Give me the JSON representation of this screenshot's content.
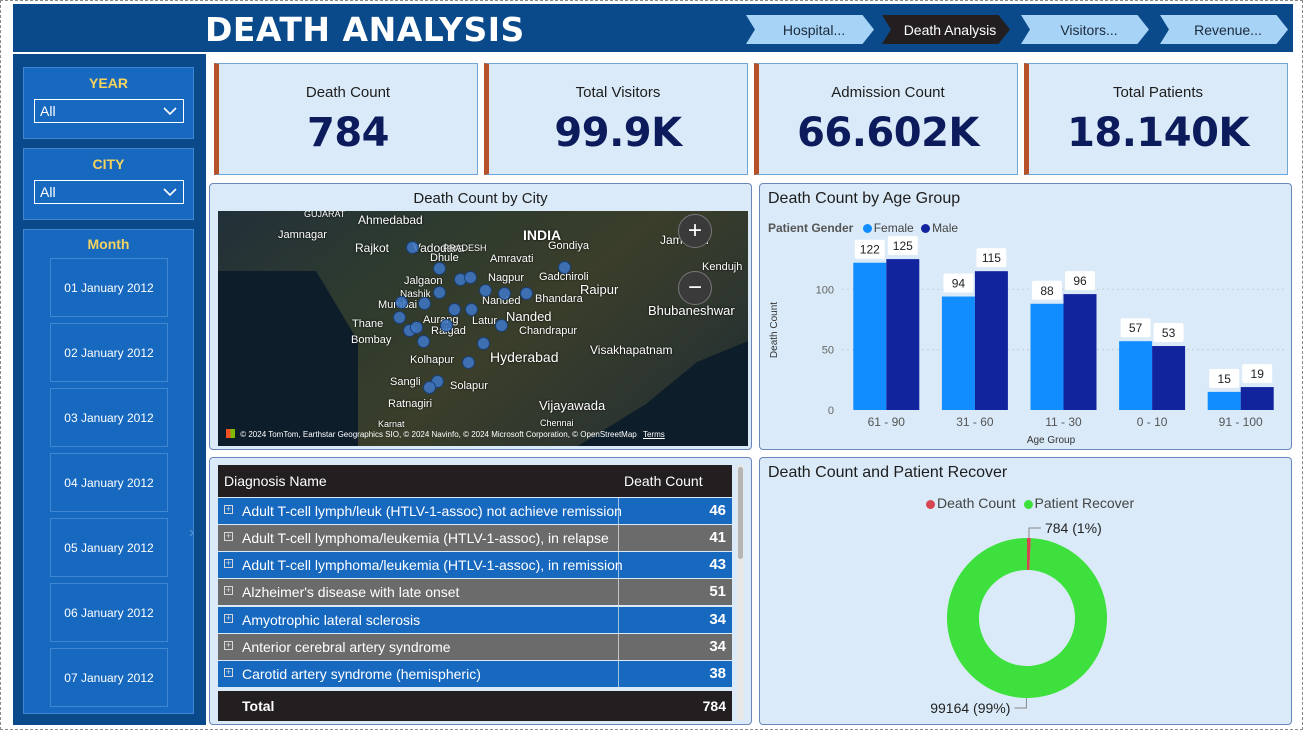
{
  "header": {
    "title": "DEATH ANALYSIS",
    "tabs": [
      {
        "label": "Hospital..."
      },
      {
        "label": "Death Analysis"
      },
      {
        "label": "Visitors..."
      },
      {
        "label": "Revenue..."
      }
    ],
    "active_tab": "Death Analysis"
  },
  "filters": {
    "year": {
      "title": "YEAR",
      "value": "All"
    },
    "city": {
      "title": "CITY",
      "value": "All"
    },
    "month": {
      "title": "Month",
      "items": [
        "01 January 2012",
        "02 January 2012",
        "03 January 2012",
        "04 January 2012",
        "05 January 2012",
        "06 January 2012",
        "07 January 2012"
      ]
    }
  },
  "kpis": [
    {
      "label": "Death Count",
      "value": "784"
    },
    {
      "label": "Total Visitors",
      "value": "99.9K"
    },
    {
      "label": "Admission Count",
      "value": "66.602K"
    },
    {
      "label": "Total Patients",
      "value": "18.140K"
    }
  ],
  "map": {
    "title": "Death Count by City",
    "labels": [
      "GUJARAT",
      "Ahmedabad",
      "Jamnagar",
      "Rajkot",
      "Vadodara",
      "PRADESH",
      "INDIA",
      "Gondiya",
      "Jamshed",
      "Dhule",
      "Amravati",
      "Nagpur",
      "Gadchiroli",
      "Kendujh",
      "Jalgaon",
      "Nashik",
      "Raipur",
      "Mumbai",
      "Nanded",
      "Bhandara",
      "Bhubaneshwar",
      "Thane",
      "Aurang",
      "Raigad",
      "Latur",
      "Nanded",
      "Chandrapur",
      "Bombay",
      "Hyderabad",
      "Visakhapatnam",
      "Kolhapur",
      "Sangli",
      "Solapur",
      "Ratnagiri",
      "Vijayawada",
      "Karnat",
      "Chennai"
    ],
    "attribution": "© 2024 TomTom, Earthstar Geographics SIO, © 2024 Navinfo, © 2024 Microsoft Corporation, © OpenStreetMap",
    "terms": "Terms",
    "zoom_in": "+",
    "zoom_out": "−"
  },
  "table": {
    "columns": [
      "Diagnosis Name",
      "Death Count"
    ],
    "rows": [
      {
        "name": "Adult T-cell lymph/leuk (HTLV-1-assoc) not achieve remission",
        "count": "46"
      },
      {
        "name": "Adult T-cell lymphoma/leukemia (HTLV-1-assoc), in relapse",
        "count": "41"
      },
      {
        "name": "Adult T-cell lymphoma/leukemia (HTLV-1-assoc), in remission",
        "count": "43"
      },
      {
        "name": "Alzheimer's disease with late onset",
        "count": "51"
      },
      {
        "name": "Amyotrophic lateral sclerosis",
        "count": "34"
      },
      {
        "name": "Anterior cerebral artery syndrome",
        "count": "34"
      },
      {
        "name": "Carotid artery syndrome (hemispheric)",
        "count": "38"
      }
    ],
    "total_label": "Total",
    "total_value": "784"
  },
  "chart_data": [
    {
      "type": "bar",
      "title": "Death Count by Age Group",
      "legend_title": "Patient Gender",
      "categories": [
        "61 - 90",
        "31 - 60",
        "11 - 30",
        "0 - 10",
        "91 - 100"
      ],
      "series": [
        {
          "name": "Female",
          "values": [
            122,
            94,
            88,
            57,
            15
          ],
          "color": "#118dff"
        },
        {
          "name": "Male",
          "values": [
            125,
            115,
            96,
            53,
            19
          ],
          "color": "#12239e"
        }
      ],
      "xlabel": "Age Group",
      "ylabel": "Death Count",
      "yticks": [
        0,
        50,
        100
      ],
      "ylim": [
        0,
        140
      ],
      "legend_position": "top-left",
      "grid": true
    },
    {
      "type": "pie",
      "title": "Death Count and Patient Recover",
      "donut": true,
      "slices": [
        {
          "name": "Death Count",
          "value": 784,
          "label": "784 (1%)",
          "color": "#d64550"
        },
        {
          "name": "Patient Recover",
          "value": 99164,
          "label": "99164 (99%)",
          "color": "#3ee03e"
        }
      ],
      "legend_position": "top-center"
    }
  ]
}
